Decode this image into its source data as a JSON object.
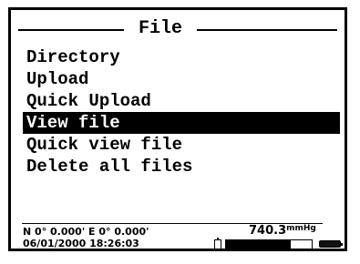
{
  "screen": {
    "title": "File",
    "menu": [
      {
        "label": "Directory",
        "selected": false
      },
      {
        "label": "Upload",
        "selected": false
      },
      {
        "label": "Quick Upload",
        "selected": false
      },
      {
        "label": "View file",
        "selected": true
      },
      {
        "label": "Quick view file",
        "selected": false
      },
      {
        "label": "Delete all files",
        "selected": false
      }
    ]
  },
  "status": {
    "coordinates": "N 0° 0.000' E 0° 0.000'",
    "datetime": "06/01/2000 18:26:03",
    "pressure_value": "740.3",
    "pressure_unit": "mmHg",
    "progress_fraction": 0.75,
    "battery_icon": "battery-icon",
    "cell_icon": "sensor-cell-icon"
  }
}
